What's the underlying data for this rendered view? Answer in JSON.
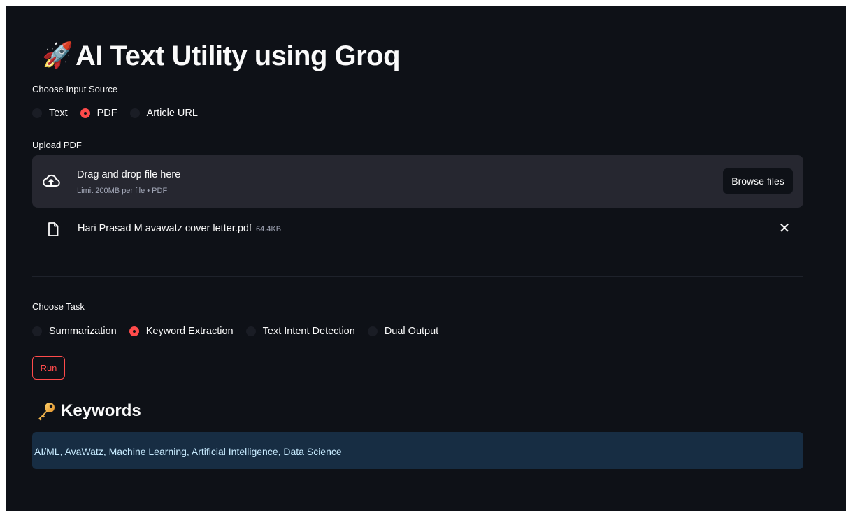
{
  "app": {
    "title_emoji": "🚀",
    "title": "AI Text Utility using Groq"
  },
  "input_source": {
    "label": "Choose Input Source",
    "options": [
      "Text",
      "PDF",
      "Article URL"
    ],
    "selected": "PDF"
  },
  "upload": {
    "label": "Upload PDF",
    "dropzone_text": "Drag and drop file here",
    "limit_text": "Limit 200MB per file • PDF",
    "browse_label": "Browse files",
    "file": {
      "name": "Hari Prasad M avawatz cover letter.pdf",
      "size": "64.4KB"
    }
  },
  "task": {
    "label": "Choose Task",
    "options": [
      "Summarization",
      "Keyword Extraction",
      "Text Intent Detection",
      "Dual Output"
    ],
    "selected": "Keyword Extraction"
  },
  "run_label": "Run",
  "result": {
    "heading_icon": "key-icon",
    "heading": "Keywords",
    "text": "AI/ML, AvaWatz, Machine Learning, Artificial Intelligence, Data Science"
  },
  "colors": {
    "background": "#0e1117",
    "accent": "#ff4b4b",
    "dropzone": "#262730",
    "info_box": "#172d43",
    "info_text": "#c7ebff"
  }
}
